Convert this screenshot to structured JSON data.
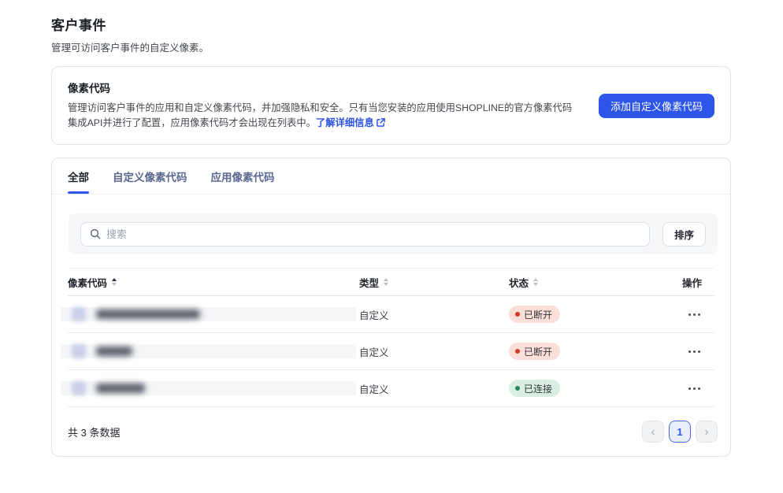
{
  "page": {
    "title": "客户事件",
    "subtitle": "管理可访问客户事件的自定义像素。"
  },
  "info_card": {
    "title": "像素代码",
    "description": "管理访问客户事件的应用和自定义像素代码，并加强隐私和安全。只有当您安装的应用使用SHOPLINE的官方像素代码集成API并进行了配置，应用像素代码才会出现在列表中。",
    "link_label": "了解详细信息",
    "add_button_label": "添加自定义像素代码"
  },
  "tabs": {
    "all": "全部",
    "custom": "自定义像素代码",
    "app": "应用像素代码"
  },
  "toolbar": {
    "search_placeholder": "搜索",
    "sort_button_label": "排序"
  },
  "table": {
    "columns": {
      "pixel_code": "像素代码",
      "type": "类型",
      "status": "状态",
      "actions": "操作"
    },
    "rows": [
      {
        "name_redacted": true,
        "type": "自定义",
        "status": "已断开",
        "status_kind": "disconnected"
      },
      {
        "name_redacted": true,
        "type": "自定义",
        "status": "已断开",
        "status_kind": "disconnected"
      },
      {
        "name_redacted": true,
        "type": "自定义",
        "status": "已连接",
        "status_kind": "connected"
      }
    ]
  },
  "footer": {
    "total_text": "共 3 条数据",
    "pagination": {
      "prev": "‹",
      "current_page": "1",
      "next": "›"
    }
  },
  "icons": {
    "search": "search-icon",
    "external_link": "external-link-icon",
    "sort": "sort-arrows-icon",
    "more": "more-horizontal-icon",
    "redacted_pixel": "pixel-logo-redacted-icon"
  },
  "colors": {
    "primary_blue": "#2e55ea",
    "link_blue": "#2d52e6",
    "status_disconnected_bg": "#fbded8",
    "status_disconnected_dot": "#d5372b",
    "status_connected_bg": "#d9efe1",
    "status_connected_dot": "#27875a",
    "toolbar_bg": "#f6f7f9",
    "redact_bg": "#f5f6f8"
  }
}
